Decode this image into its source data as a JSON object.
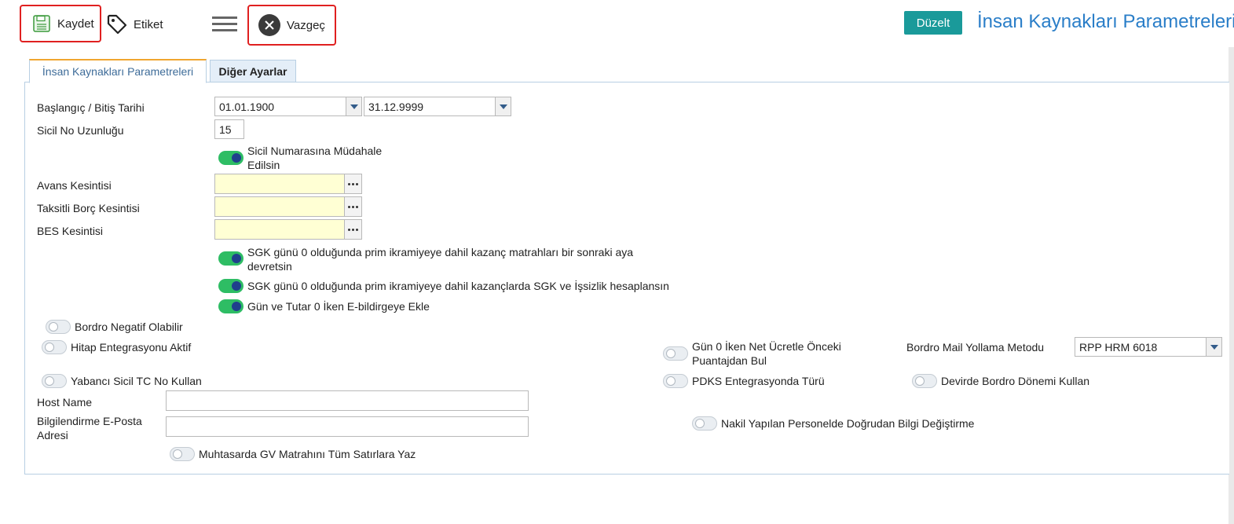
{
  "toolbar": {
    "save_label": "Kaydet",
    "tag_label": "Etiket",
    "cancel_label": "Vazgeç",
    "edit_label": "Düzelt",
    "page_title": "İnsan Kaynakları Parametreleri"
  },
  "tabs": [
    {
      "label": "İnsan Kaynakları Parametreleri",
      "active": true
    },
    {
      "label": "Diğer Ayarlar",
      "active": false
    }
  ],
  "form": {
    "date_range_label": "Başlangıç / Bitiş Tarihi",
    "start_date": "01.01.1900",
    "end_date": "31.12.9999",
    "sicil_length_label": "Sicil No Uzunluğu",
    "sicil_length_value": "15",
    "sicil_intervene_line1": "Sicil Numarasına Müdahale",
    "sicil_intervene_line2": "Edilsin",
    "avans_label": "Avans Kesintisi",
    "taksitli_label": "Taksitli Borç Kesintisi",
    "bes_label": "BES Kesintisi",
    "sgk_devret_line1": "SGK günü 0 olduğunda prim ikramiyeye dahil kazanç matrahları bir sonraki aya",
    "sgk_devret_line2": "devretsin",
    "sgk_hesap_label": "SGK günü 0 olduğunda prim ikramiyeye dahil kazançlarda SGK ve İşsizlik hesaplansın",
    "gun_tutar_label": "Gün ve Tutar 0 İken E-bildirgeye Ekle",
    "bordro_negatif_label": "Bordro Negatif Olabilir",
    "hitap_label": "Hitap Entegrasyonu Aktif",
    "gun0_net_line1": "Gün 0 İken Net Ücretle Önceki",
    "gun0_net_line2": "Puantajdan Bul",
    "mail_method_label": "Bordro Mail Yollama Metodu",
    "mail_method_value": "RPP HRM 6018",
    "yabanci_label": "Yabancı Sicil TC No Kullan",
    "pdks_label": "PDKS Entegrasyonda Türü",
    "devir_label": "Devirde Bordro Dönemi Kullan",
    "host_label": "Host Name",
    "host_value": "",
    "email_line1": "Bilgilendirme E-Posta",
    "email_line2": "Adresi",
    "email_value": "",
    "nakil_label": "Nakil Yapılan Personelde Doğrudan Bilgi Değiştirme",
    "muhtasar_label": "Muhtasarda GV Matrahını Tüm Satırlara Yaz"
  },
  "toggles": {
    "sicil_intervene": "on",
    "sgk_devret": "on",
    "sgk_hesap": "on",
    "gun_tutar": "on",
    "bordro_negatif": "off",
    "hitap": "off",
    "gun0_net": "off",
    "yabanci": "off",
    "pdks": "off",
    "devir": "off",
    "nakil": "off",
    "muhtasar": "off"
  },
  "colors": {
    "accent": "#2a7ec8",
    "edit_button": "#1a9a9a",
    "toggle_on": "#2ebd64",
    "highlight": "#e02020"
  }
}
